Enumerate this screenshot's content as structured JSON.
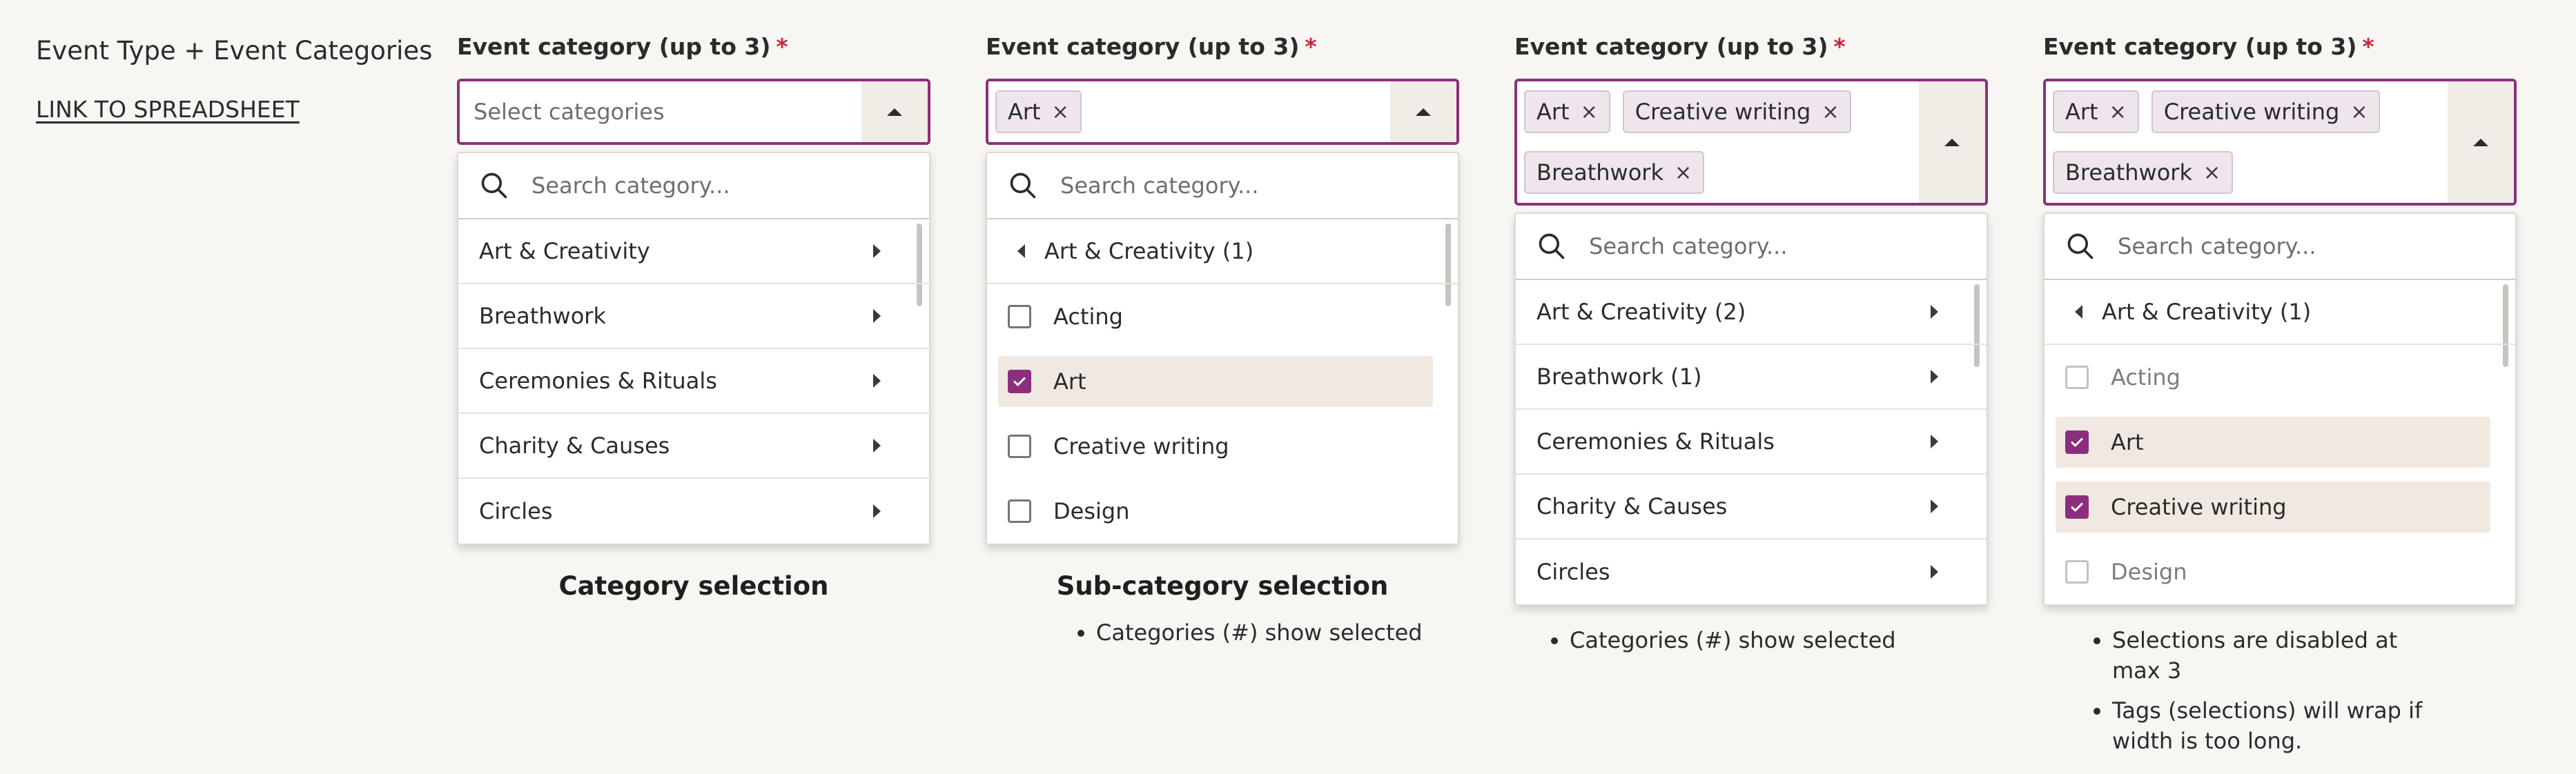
{
  "page_title": "Event Type + Event Categories",
  "link_label": "LINK TO SPREADSHEET",
  "field_label": "Event category (up to 3)",
  "required_mark": "*",
  "search_placeholder": "Search category...",
  "tag_remove_glyph": "×",
  "panels": [
    {
      "select_placeholder": "Select categories",
      "categories": [
        "Art & Creativity",
        "Breathwork",
        "Ceremonies & Rituals",
        "Charity & Causes",
        "Circles"
      ],
      "caption": "Category selection"
    },
    {
      "tags": [
        "Art"
      ],
      "back_label": "Art & Creativity (1)",
      "options": [
        {
          "label": "Acting",
          "checked": false
        },
        {
          "label": "Art",
          "checked": true
        },
        {
          "label": "Creative writing",
          "checked": false
        },
        {
          "label": "Design",
          "checked": false
        }
      ],
      "caption": "Sub-category selection",
      "notes": [
        "Categories (#) show selected"
      ]
    },
    {
      "tags": [
        "Art",
        "Creative writing",
        "Breathwork"
      ],
      "categories": [
        "Art & Creativity (2)",
        "Breathwork (1)",
        "Ceremonies & Rituals",
        "Charity & Causes",
        "Circles"
      ],
      "notes": [
        "Categories (#) show selected"
      ]
    },
    {
      "tags": [
        "Art",
        "Creative writing",
        "Breathwork"
      ],
      "back_label": "Art & Creativity (1)",
      "options": [
        {
          "label": "Acting",
          "checked": false,
          "disabled": true
        },
        {
          "label": "Art",
          "checked": true
        },
        {
          "label": "Creative writing",
          "checked": true
        },
        {
          "label": "Design",
          "checked": false,
          "disabled": true
        }
      ],
      "notes": [
        "Selections are disabled at max 3",
        "Tags (selections) will wrap if width is too long."
      ]
    }
  ]
}
